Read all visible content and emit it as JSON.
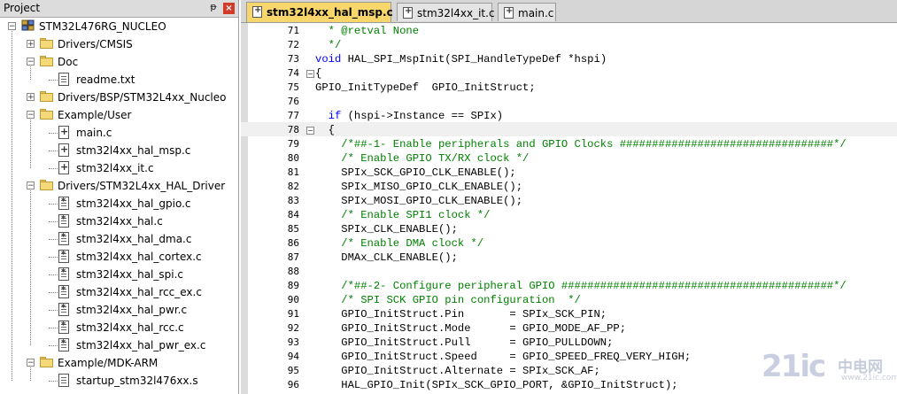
{
  "project_pane": {
    "title": "Project",
    "pin_glyph": "ᵽ",
    "close_glyph": "×",
    "tree": [
      {
        "label": "STM32L476RG_NUCLEO",
        "kind": "project",
        "depth": 0,
        "expander": "−"
      },
      {
        "label": "Drivers/CMSIS",
        "kind": "folder",
        "depth": 1,
        "expander": "+"
      },
      {
        "label": "Doc",
        "kind": "folder",
        "depth": 1,
        "expander": "−"
      },
      {
        "label": "readme.txt",
        "kind": "file",
        "depth": 2
      },
      {
        "label": "Drivers/BSP/STM32L4xx_Nucleo",
        "kind": "folder",
        "depth": 1,
        "expander": "+"
      },
      {
        "label": "Example/User",
        "kind": "folder",
        "depth": 1,
        "expander": "−"
      },
      {
        "label": "main.c",
        "kind": "cfile",
        "depth": 2
      },
      {
        "label": "stm32l4xx_hal_msp.c",
        "kind": "cfile",
        "depth": 2
      },
      {
        "label": "stm32l4xx_it.c",
        "kind": "cfile",
        "depth": 2
      },
      {
        "label": "Drivers/STM32L4xx_HAL_Driver",
        "kind": "folder",
        "depth": 1,
        "expander": "−"
      },
      {
        "label": "stm32l4xx_hal_gpio.c",
        "kind": "hfile",
        "depth": 2
      },
      {
        "label": "stm32l4xx_hal.c",
        "kind": "hfile",
        "depth": 2
      },
      {
        "label": "stm32l4xx_hal_dma.c",
        "kind": "hfile",
        "depth": 2
      },
      {
        "label": "stm32l4xx_hal_cortex.c",
        "kind": "hfile",
        "depth": 2
      },
      {
        "label": "stm32l4xx_hal_spi.c",
        "kind": "hfile",
        "depth": 2
      },
      {
        "label": "stm32l4xx_hal_rcc_ex.c",
        "kind": "hfile",
        "depth": 2
      },
      {
        "label": "stm32l4xx_hal_pwr.c",
        "kind": "hfile",
        "depth": 2
      },
      {
        "label": "stm32l4xx_hal_rcc.c",
        "kind": "hfile",
        "depth": 2
      },
      {
        "label": "stm32l4xx_hal_pwr_ex.c",
        "kind": "hfile",
        "depth": 2
      },
      {
        "label": "Example/MDK-ARM",
        "kind": "folder",
        "depth": 1,
        "expander": "−"
      },
      {
        "label": "startup_stm32l476xx.s",
        "kind": "file",
        "depth": 2
      }
    ]
  },
  "editor": {
    "tabs": [
      {
        "label": "stm32l4xx_hal_msp.c",
        "active": true
      },
      {
        "label": "stm32l4xx_it.c",
        "active": false
      },
      {
        "label": "main.c",
        "active": false
      }
    ],
    "lines": [
      {
        "num": "71",
        "fold": "",
        "segs": [
          {
            "t": "  * @retval None",
            "c": "cmt"
          }
        ]
      },
      {
        "num": "72",
        "fold": "",
        "segs": [
          {
            "t": "  */",
            "c": "cmt"
          }
        ]
      },
      {
        "num": "73",
        "fold": "",
        "segs": [
          {
            "t": "void",
            "c": "kw"
          },
          {
            "t": " HAL_SPI_MspInit(SPI_HandleTypeDef *hspi)",
            "c": ""
          }
        ]
      },
      {
        "num": "74",
        "fold": "⊟",
        "segs": [
          {
            "t": "{",
            "c": ""
          }
        ]
      },
      {
        "num": "75",
        "fold": "",
        "segs": [
          {
            "t": "GPIO_InitTypeDef  GPIO_InitStruct;",
            "c": ""
          }
        ]
      },
      {
        "num": "76",
        "fold": "",
        "segs": [
          {
            "t": "",
            "c": ""
          }
        ]
      },
      {
        "num": "77",
        "fold": "",
        "segs": [
          {
            "t": "  ",
            "c": ""
          },
          {
            "t": "if",
            "c": "kw"
          },
          {
            "t": " (hspi->Instance == SPIx)",
            "c": ""
          }
        ]
      },
      {
        "num": "78",
        "fold": "⊟",
        "segs": [
          {
            "t": "  {",
            "c": ""
          }
        ]
      },
      {
        "num": "79",
        "fold": "",
        "segs": [
          {
            "t": "    /*##-1- Enable peripherals and GPIO Clocks #################################*/",
            "c": "cmt"
          }
        ]
      },
      {
        "num": "80",
        "fold": "",
        "segs": [
          {
            "t": "    /* Enable GPIO TX/RX clock */",
            "c": "cmt"
          }
        ]
      },
      {
        "num": "81",
        "fold": "",
        "segs": [
          {
            "t": "    SPIx_SCK_GPIO_CLK_ENABLE();",
            "c": ""
          }
        ]
      },
      {
        "num": "82",
        "fold": "",
        "segs": [
          {
            "t": "    SPIx_MISO_GPIO_CLK_ENABLE();",
            "c": ""
          }
        ]
      },
      {
        "num": "83",
        "fold": "",
        "segs": [
          {
            "t": "    SPIx_MOSI_GPIO_CLK_ENABLE();",
            "c": ""
          }
        ]
      },
      {
        "num": "84",
        "fold": "",
        "segs": [
          {
            "t": "    /* Enable SPI1 clock */",
            "c": "cmt"
          }
        ]
      },
      {
        "num": "85",
        "fold": "",
        "segs": [
          {
            "t": "    SPIx_CLK_ENABLE();",
            "c": ""
          }
        ]
      },
      {
        "num": "86",
        "fold": "",
        "segs": [
          {
            "t": "    /* Enable DMA clock */",
            "c": "cmt"
          }
        ]
      },
      {
        "num": "87",
        "fold": "",
        "segs": [
          {
            "t": "    DMAx_CLK_ENABLE();",
            "c": ""
          }
        ]
      },
      {
        "num": "88",
        "fold": "",
        "segs": [
          {
            "t": "",
            "c": ""
          }
        ]
      },
      {
        "num": "89",
        "fold": "",
        "segs": [
          {
            "t": "    /*##-2- Configure peripheral GPIO ##########################################*/",
            "c": "cmt"
          }
        ]
      },
      {
        "num": "90",
        "fold": "",
        "segs": [
          {
            "t": "    /* SPI SCK GPIO pin configuration  */",
            "c": "cmt"
          }
        ]
      },
      {
        "num": "91",
        "fold": "",
        "segs": [
          {
            "t": "    GPIO_InitStruct.Pin       = SPIx_SCK_PIN;",
            "c": ""
          }
        ]
      },
      {
        "num": "92",
        "fold": "",
        "segs": [
          {
            "t": "    GPIO_InitStruct.Mode      = GPIO_MODE_AF_PP;",
            "c": ""
          }
        ]
      },
      {
        "num": "93",
        "fold": "",
        "segs": [
          {
            "t": "    GPIO_InitStruct.Pull      = GPIO_PULLDOWN;",
            "c": ""
          }
        ]
      },
      {
        "num": "94",
        "fold": "",
        "segs": [
          {
            "t": "    GPIO_InitStruct.Speed     = GPIO_SPEED_FREQ_VERY_HIGH;",
            "c": ""
          }
        ]
      },
      {
        "num": "95",
        "fold": "",
        "segs": [
          {
            "t": "    GPIO_InitStruct.Alternate = SPIx_SCK_AF;",
            "c": ""
          }
        ]
      },
      {
        "num": "96",
        "fold": "",
        "segs": [
          {
            "t": "    HAL_GPIO_Init(SPIx_SCK_GPIO_PORT, &GPIO_InitStruct);",
            "c": ""
          }
        ]
      }
    ]
  },
  "watermark": {
    "number": "21ic",
    "text": "中电网",
    "domain": "www.21ic.com"
  },
  "colors": {
    "active_tab": "#f7d76b",
    "comment": "#008000",
    "keyword": "#0000ff"
  }
}
